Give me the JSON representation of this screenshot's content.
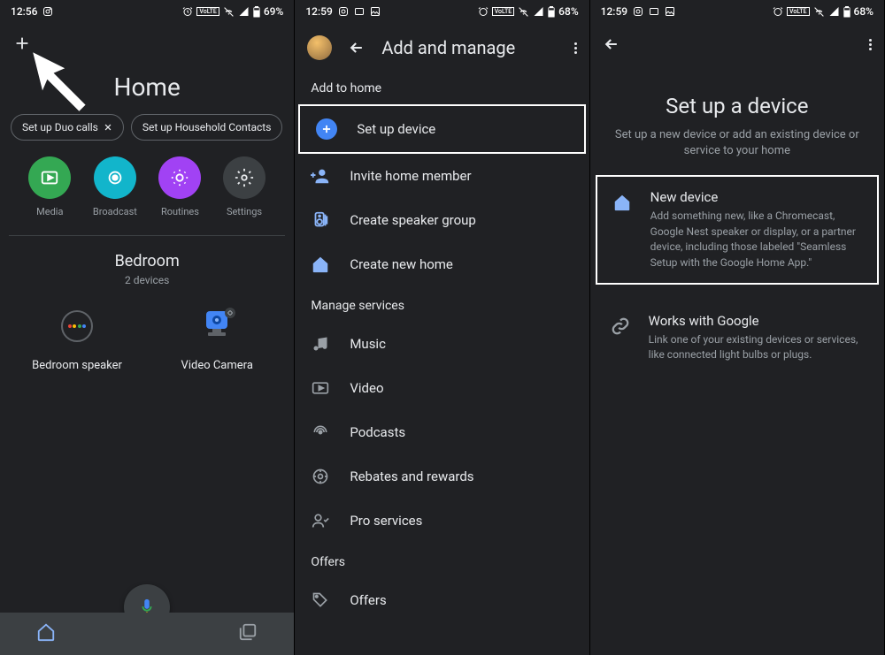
{
  "panel1": {
    "status": {
      "time": "12:56",
      "battery": "69%"
    },
    "title": "Home",
    "chips": [
      {
        "label": "Set up Duo calls"
      },
      {
        "label": "Set up Household Contacts"
      }
    ],
    "actions": [
      {
        "label": "Media"
      },
      {
        "label": "Broadcast"
      },
      {
        "label": "Routines"
      },
      {
        "label": "Settings"
      }
    ],
    "room": {
      "name": "Bedroom",
      "sub": "2 devices"
    },
    "devices": [
      {
        "label": "Bedroom speaker"
      },
      {
        "label": "Video Camera"
      }
    ]
  },
  "panel2": {
    "status": {
      "time": "12:59",
      "battery": "68%"
    },
    "title": "Add and manage",
    "sections": {
      "add_to_home": "Add to home",
      "manage_services": "Manage services",
      "offers": "Offers"
    },
    "items": {
      "setup_device": "Set up device",
      "invite": "Invite home member",
      "speaker_group": "Create speaker group",
      "new_home": "Create new home",
      "music": "Music",
      "video": "Video",
      "podcasts": "Podcasts",
      "rebates": "Rebates and rewards",
      "pro": "Pro services",
      "offers": "Offers"
    }
  },
  "panel3": {
    "status": {
      "time": "12:59",
      "battery": "68%"
    },
    "title": "Set up a device",
    "sub": "Set up a new device or add an existing device or service to your home",
    "options": {
      "new_device": {
        "title": "New device",
        "desc": "Add something new, like a Chromecast, Google Nest speaker or display, or a partner device, including those labeled \"Seamless Setup with the Google Home App.\""
      },
      "works_with": {
        "title": "Works with Google",
        "desc": "Link one of your existing devices or services, like connected light bulbs or plugs."
      }
    }
  }
}
